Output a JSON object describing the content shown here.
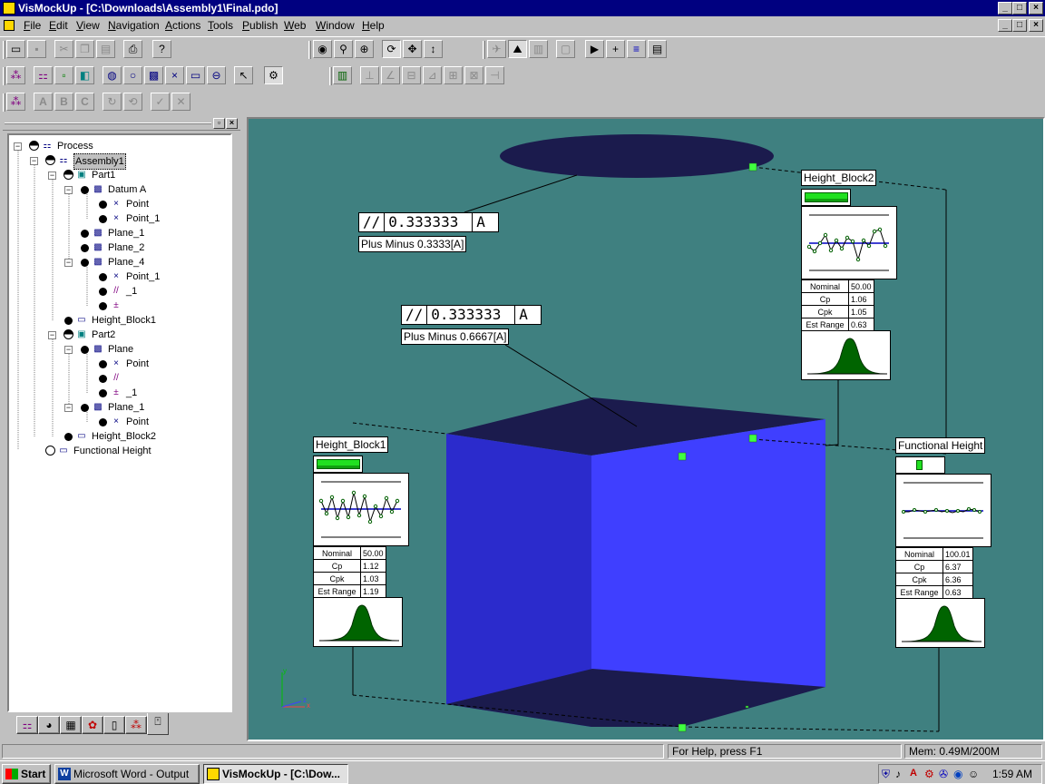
{
  "window": {
    "title": "VisMockUp - [C:\\Downloads\\Assembly1\\Final.pdo]"
  },
  "menu": [
    {
      "label": "File",
      "hotkey": "F"
    },
    {
      "label": "Edit",
      "hotkey": "E"
    },
    {
      "label": "View",
      "hotkey": "V"
    },
    {
      "label": "Navigation",
      "hotkey": "N"
    },
    {
      "label": "Actions",
      "hotkey": "A"
    },
    {
      "label": "Tools",
      "hotkey": "T"
    },
    {
      "label": "Publish",
      "hotkey": "P"
    },
    {
      "label": "Web",
      "hotkey": "W"
    },
    {
      "label": "Window",
      "hotkey": "W"
    },
    {
      "label": "Help",
      "hotkey": "H"
    }
  ],
  "toolbar_row3_letters": [
    "A",
    "B",
    "C"
  ],
  "tree": [
    {
      "label": "Process"
    },
    {
      "label": "Assembly1",
      "selected": true
    },
    {
      "label": "Part1"
    },
    {
      "label": "Datum A"
    },
    {
      "label": "Point"
    },
    {
      "label": "Point_1"
    },
    {
      "label": "Plane_1"
    },
    {
      "label": "Plane_2"
    },
    {
      "label": "Plane_4"
    },
    {
      "label": "Point_1"
    },
    {
      "label": "_1"
    },
    {
      "label": ""
    },
    {
      "label": "Height_Block1"
    },
    {
      "label": "Part2"
    },
    {
      "label": "Plane"
    },
    {
      "label": "Point"
    },
    {
      "label": ""
    },
    {
      "label": "_1"
    },
    {
      "label": "Plane_1"
    },
    {
      "label": "Point"
    },
    {
      "label": "Height_Block2"
    },
    {
      "label": "Functional Height"
    }
  ],
  "callouts": {
    "fcf1": {
      "symbol": "//",
      "value": "0.333333",
      "datum": "A",
      "note": "Plus Minus 0.3333[A]"
    },
    "fcf2": {
      "symbol": "//",
      "value": "0.333333",
      "datum": "A",
      "note": "Plus Minus 0.6667[A]"
    }
  },
  "panels": {
    "hb1": {
      "title": "Height_Block1",
      "stats": {
        "nominal_label": "Nominal",
        "nominal": "50.00",
        "cp_label": "Cp",
        "cp": "1.12",
        "cpk_label": "Cpk",
        "cpk": "1.03",
        "range_label": "Est Range",
        "range": "1.19"
      }
    },
    "hb2": {
      "title": "Height_Block2",
      "stats": {
        "nominal_label": "Nominal",
        "nominal": "50.00",
        "cp_label": "Cp",
        "cp": "1.06",
        "cpk_label": "Cpk",
        "cpk": "1.05",
        "range_label": "Est Range",
        "range": "0.63"
      }
    },
    "fh": {
      "title": "Functional Height",
      "stats": {
        "nominal_label": "Nominal",
        "nominal": "100.01",
        "cp_label": "Cp",
        "cp": "6.37",
        "cpk_label": "Cpk",
        "cpk": "6.36",
        "range_label": "Est Range",
        "range": "0.63"
      }
    }
  },
  "axes": {
    "x": "x",
    "y": "y",
    "z": "z"
  },
  "statusbar": {
    "help": "For Help, press F1",
    "memory": "Mem: 0.49M/200M"
  },
  "taskbar": {
    "start": "Start",
    "task1": "Microsoft Word - Output",
    "task2": "VisMockUp - [C:\\Dow...",
    "clock": "1:59 AM"
  },
  "colors": {
    "viewport": "#3f8080",
    "title": "#000080",
    "front_face": "#3f3fff",
    "side_face": "#2b2bcc",
    "top_face": "#1b1b4d",
    "marker": "#40ff40",
    "bell": "#006400"
  }
}
